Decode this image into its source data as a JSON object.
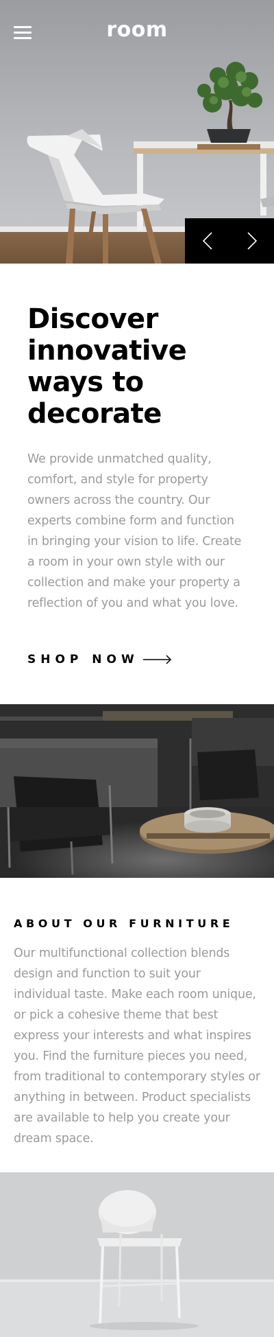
{
  "header": {
    "logo": "room",
    "menu_icon": "hamburger-menu-icon"
  },
  "slider": {
    "prev_icon": "chevron-left-icon",
    "next_icon": "chevron-right-icon"
  },
  "discover": {
    "title_lines": [
      "Discover",
      "innovative",
      "ways to",
      "decorate"
    ],
    "body": "We provide unmatched quality, comfort, and style for property owners across the country. Our experts combine form and function in bringing your vision to life. Create a room in your own style with our collection and make your property a reflection of you and what you love.",
    "cta_label": "SHOP NOW",
    "cta_icon": "arrow-right-icon"
  },
  "about": {
    "title": "ABOUT OUR FURNITURE",
    "body": "Our multifunctional collection blends design and function to suit your individual taste. Make each room unique, or pick a cohesive theme that best express your interests and what inspires you. Find the furniture pieces you need, from traditional to contemporary styles or anything in between. Product specialists are available to help you create your dream space."
  },
  "colors": {
    "text_dark": "#000000",
    "text_muted": "#9a9a9a",
    "background": "#ffffff",
    "slider_bg": "#000000"
  }
}
